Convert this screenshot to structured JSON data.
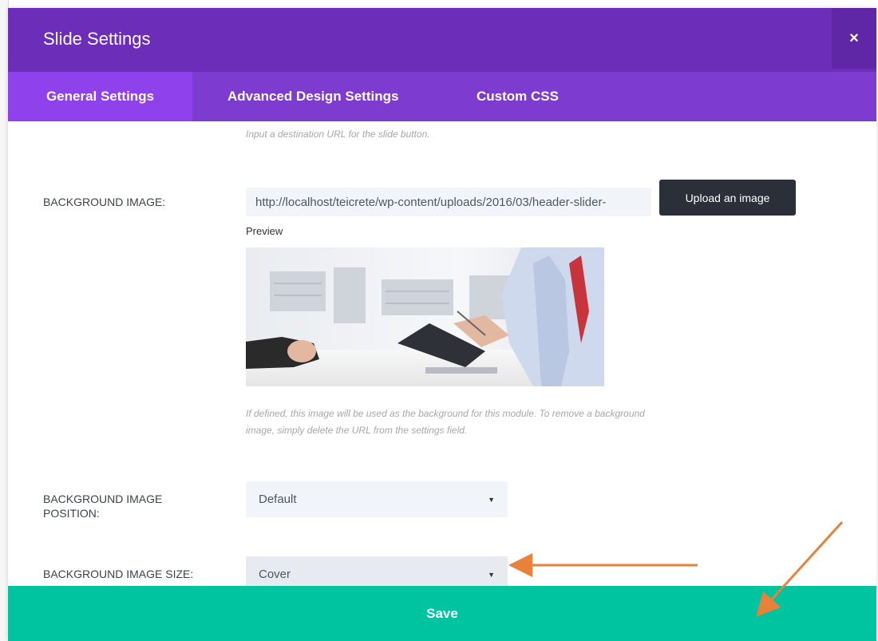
{
  "modal": {
    "title": "Slide Settings",
    "close_glyph": "×"
  },
  "tabs": [
    {
      "label": "General Settings",
      "active": true
    },
    {
      "label": "Advanced Design Settings",
      "active": false
    },
    {
      "label": "Custom CSS",
      "active": false
    }
  ],
  "button_url": {
    "help": "Input a destination URL for the slide button."
  },
  "background_image": {
    "label": "BACKGROUND IMAGE:",
    "value": "http://localhost/teicrete/wp-content/uploads/2016/03/header-slider-",
    "upload_label": "Upload an image",
    "preview_label": "Preview",
    "help_line1": "If defined, this image will be used as the background for this module. To remove a background",
    "help_line2": "image, simply delete the URL from the settings field."
  },
  "background_position": {
    "label_line1": "BACKGROUND IMAGE",
    "label_line2": "POSITION:",
    "selected": "Default"
  },
  "background_size": {
    "label": "BACKGROUND IMAGE SIZE:",
    "selected": "Cover"
  },
  "save_label": "Save",
  "colors": {
    "header": "#6c2eb9",
    "tabs": "#7e3bd0",
    "active_tab": "#8f42ec",
    "save": "#00c39f",
    "annotation_arrow": "#e8823a"
  },
  "icons": {
    "close": "close-icon",
    "dropdown": "chevron-down-icon",
    "annotation": "arrow-annotation"
  }
}
